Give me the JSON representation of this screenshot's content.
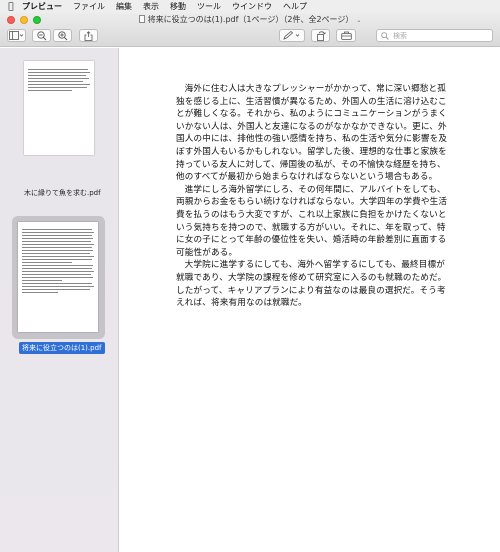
{
  "menubar": {
    "items": [
      "プレビュー",
      "ファイル",
      "編集",
      "表示",
      "移動",
      "ツール",
      "ウインドウ",
      "ヘルプ"
    ]
  },
  "window": {
    "title": "将来に役立つのは(1).pdf（1ページ）（2件、全2ページ）"
  },
  "toolbar": {
    "search_placeholder": "検索"
  },
  "sidebar": {
    "thumbnails": [
      {
        "label": "木に縁りて魚を求む.pdf"
      },
      {
        "label": "将来に役立つのは(1).pdf"
      }
    ]
  },
  "document": {
    "paragraphs": [
      "海外に住む人は大きなプレッシャーがかかって、常に深い郷愁と孤独を感じる上に、生活習慣が異なるため、外国人の生活に溶け込むことが難しくなる。それから、私のようにコミュニケーションがうまくいかない人は、外国人と友達になるのがなかなかできない。更に、外国人の中には、排他性の強い感情を持ち、私の生活や気分に影響を及ぼす外国人もいるかもしれない。留学した後、理想的な仕事と家族を持っている友人に対して、帰国後の私が、その不愉快な経歴を持ち、他のすべてが最初から始まらなければならないという場合もある。",
      "進学にしろ海外留学にしろ、その何年間に、アルバイトをしても、両親からお金をもらい続けなければならない。大学四年の学費や生活費を払うのはもう大変ですが、これ以上家族に負担をかけたくないという気持ちを持つので、就職する方がいい。それに、年を取って、特に女の子にとって年齢の優位性を失い、婚活時の年齢差別に直面する可能性がある。",
      "大学院に進学するにしても、海外へ留学するにしても、最終目標が就職であり、大学院の課程を修めて研究室に入るのも就職のためだ。したがって、キャリアプランにより有益なのは最良の選択だ。そう考えれば、将来有用なのは就職だ。"
    ]
  }
}
